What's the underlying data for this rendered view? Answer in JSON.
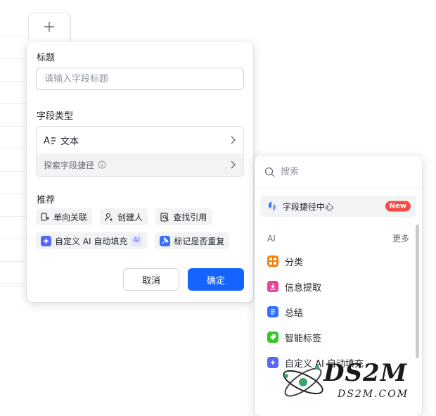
{
  "background": {
    "add_column_icon": "plus-icon"
  },
  "panel": {
    "title_label": "标题",
    "title_placeholder": "请输入字段标题",
    "type_label": "字段类型",
    "type_value": "文本",
    "explore_label": "探索字段捷径",
    "recommend_label": "推荐",
    "chips": [
      {
        "label": "单向关联",
        "icon": "link-icon"
      },
      {
        "label": "创建人",
        "icon": "user-add-icon"
      },
      {
        "label": "查找引用",
        "icon": "lookup-icon"
      },
      {
        "label": "自定义 AI 自动填充",
        "icon": "ai-sparkle-icon",
        "badge": "AI"
      },
      {
        "label": "标记是否重复",
        "icon": "pin-icon"
      }
    ],
    "cancel_label": "取消",
    "confirm_label": "确定"
  },
  "dropdown": {
    "search_placeholder": "搜索",
    "hub_label": "字段捷径中心",
    "new_badge": "New",
    "section_title": "AI",
    "more_label": "更多",
    "items": [
      {
        "label": "分类",
        "color": "#ff7d00"
      },
      {
        "label": "信息提取",
        "color": "#e6439a"
      },
      {
        "label": "总结",
        "color": "#3370ff"
      },
      {
        "label": "智能标签",
        "color": "#34c724"
      },
      {
        "label": "自定义 AI 自动填充",
        "color": "#5b65f5"
      }
    ]
  },
  "watermark": {
    "big": "DS2M",
    "small": "DS2M.COM"
  },
  "colors": {
    "primary": "#1664ff",
    "badge_red": "#f54a45"
  }
}
